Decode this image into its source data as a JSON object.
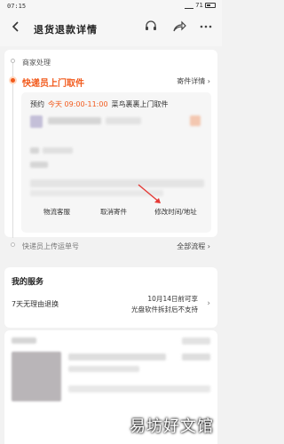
{
  "status_bar": {
    "time": "07:15",
    "battery": "71"
  },
  "header": {
    "back_icon": "arrow-left-icon",
    "title": "退货退款详情",
    "icons": [
      "headset-icon",
      "share-icon",
      "more-icon"
    ]
  },
  "timeline": {
    "steps": [
      {
        "label": "商家处理"
      },
      {
        "label": "快递员上门取件",
        "link": "寄件详情 ›"
      },
      {
        "label": "快递员上传运单号",
        "link": "全部流程 ›"
      }
    ],
    "appointment": {
      "label": "预约",
      "time": "今天 09:00-11:00",
      "status": "菜鸟裹裹上门取件"
    },
    "buttons": [
      "物流客服",
      "取消寄件",
      "修改时间/地址"
    ],
    "arrow_color": "#e53935"
  },
  "service": {
    "title": "我的服务",
    "left": "7天无理由退换",
    "right_line1": "10月14日前可享",
    "right_line2": "光盘软件拆封后不支持",
    "chevron": "›"
  },
  "watermark": "易坊好文馆",
  "colors": {
    "accent": "#f25a1c",
    "background": "#f2f2f2"
  }
}
